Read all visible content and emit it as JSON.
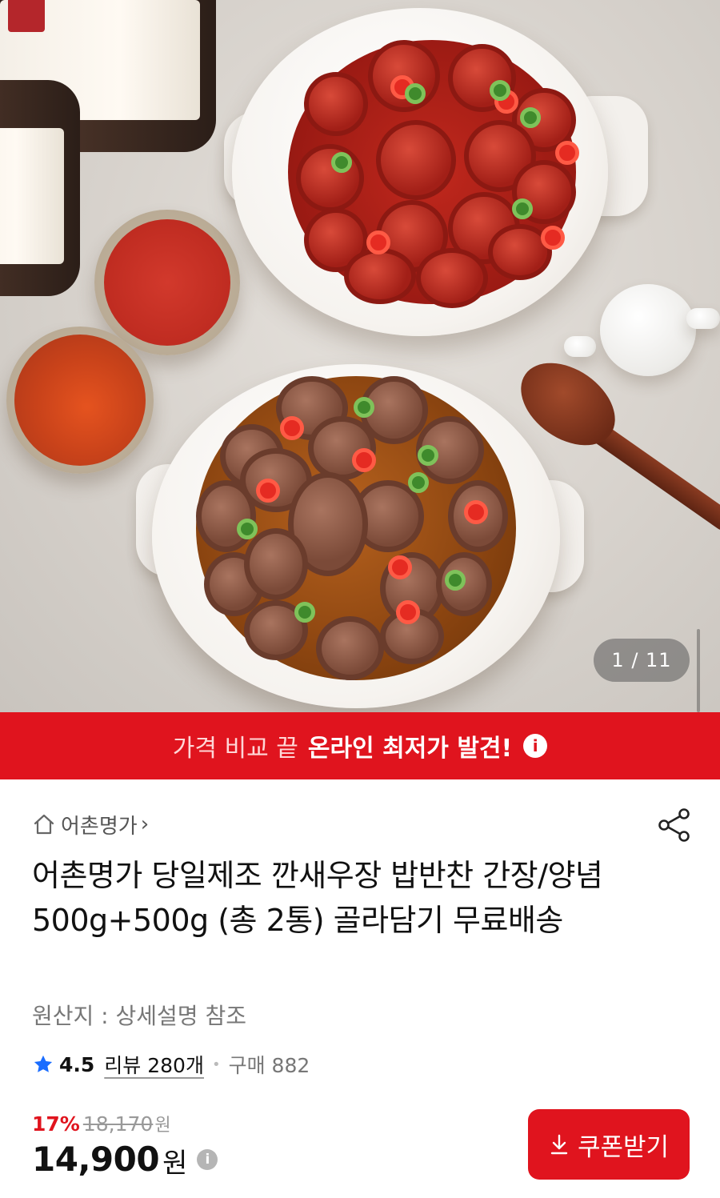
{
  "hero": {
    "image_alt": "product-photo-shrimp-dishes",
    "page_counter": "1 / 11"
  },
  "banner": {
    "light_text": "가격 비교 끝",
    "bold_text": "온라인 최저가 발견!",
    "info_icon": "i"
  },
  "store": {
    "name": "어촌명가",
    "chevron": "›"
  },
  "product": {
    "title": "어촌명가 당일제조 깐새우장 밥반찬 간장/양념 500g+500g (총 2통) 골라담기 무료배송",
    "origin": "원산지 : 상세설명 참조"
  },
  "rating": {
    "score": "4.5",
    "reviews": "리뷰 280개",
    "purchases": "구매 882"
  },
  "price": {
    "discount": "17%",
    "original": "18,170",
    "original_unit": "원",
    "current": "14,900",
    "current_unit": "원",
    "info_icon": "i"
  },
  "coupon": {
    "label": "쿠폰받기"
  },
  "colors": {
    "accent_red": "#e0141e",
    "star_blue": "#1a6dff"
  }
}
